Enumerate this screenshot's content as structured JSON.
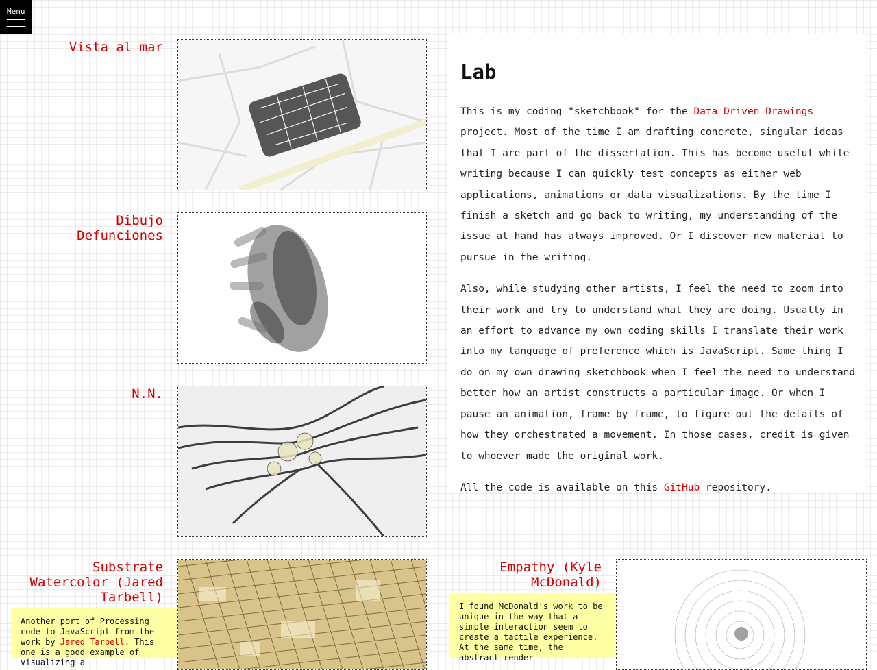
{
  "menu": {
    "label": "Menu"
  },
  "intro": {
    "heading": "Lab",
    "p1_a": "This is my coding \"sketchbook\" for the ",
    "p1_link": "Data Driven Drawings",
    "p1_b": " project. Most of the time I am drafting concrete, singular ideas that I are part of the dissertation. This has become useful while writing because I can quickly test concepts as either web applications, animations or data visualizations. By the time I finish a sketch and go back to writing, my understanding of the issue at hand has always improved. Or I discover new material to pursue in the writing.",
    "p2": "Also, while studying other artists, I feel the need to zoom into their work and try to understand what they are doing. Usually in an effort to advance my own coding skills I translate their work into my language of preference which is JavaScript. Same thing I do on my own drawing sketchbook when I feel the need to understand better how an artist constructs a particular image. Or when I pause an animation, frame by frame, to figure out the details of how they orchestrated a movement. In those cases, credit is given to whoever made the original work.",
    "p3_a": "All the code is available on this ",
    "p3_link": "GitHub",
    "p3_b": " repository."
  },
  "sketches": [
    {
      "title": "Vista al mar"
    },
    {
      "title": "Dibujo Defunciones"
    },
    {
      "title": "N.N."
    },
    {
      "title": "Substrate Watercolor (Jared Tarbell)",
      "note_a": "Another port of Processing code to JavaScript from the work by ",
      "note_link": "Jared Tarbell.",
      "note_b": " This one is a good example of visualizing a"
    },
    {
      "title": "Empathy (Kyle McDonald)",
      "note": "I found McDonald's work to be unique in the way that a simple interaction seem to create a tactile experience. At the same time, the abstract render"
    }
  ],
  "colors": {
    "link": "#d40000",
    "note_bg": "#ffffa3",
    "menu_bg": "#000000"
  },
  "icons": {
    "menu": "hamburger-icon"
  }
}
